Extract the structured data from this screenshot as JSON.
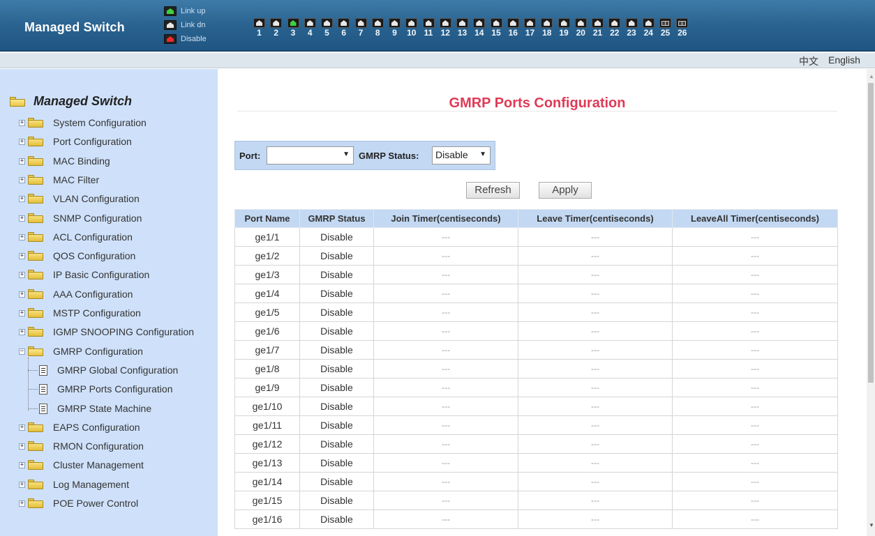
{
  "header": {
    "brand": "Managed Switch",
    "legend": [
      {
        "label": "Link up",
        "icon": "port-link-up-icon",
        "color": "#3fd23f"
      },
      {
        "label": "Link dn",
        "icon": "port-link-down-icon",
        "color": "#e8e8e8"
      },
      {
        "label": "Disable",
        "icon": "port-disabled-icon",
        "color": "#ee2a2a"
      }
    ],
    "ports": [
      {
        "num": "1",
        "state": "down"
      },
      {
        "num": "2",
        "state": "down"
      },
      {
        "num": "3",
        "state": "up"
      },
      {
        "num": "4",
        "state": "down"
      },
      {
        "num": "5",
        "state": "down"
      },
      {
        "num": "6",
        "state": "down"
      },
      {
        "num": "7",
        "state": "down"
      },
      {
        "num": "8",
        "state": "down"
      },
      {
        "num": "9",
        "state": "down"
      },
      {
        "num": "10",
        "state": "down"
      },
      {
        "num": "11",
        "state": "down"
      },
      {
        "num": "12",
        "state": "down"
      },
      {
        "num": "13",
        "state": "down"
      },
      {
        "num": "14",
        "state": "down"
      },
      {
        "num": "15",
        "state": "down"
      },
      {
        "num": "16",
        "state": "down"
      },
      {
        "num": "17",
        "state": "down"
      },
      {
        "num": "18",
        "state": "down"
      },
      {
        "num": "19",
        "state": "down"
      },
      {
        "num": "20",
        "state": "down"
      },
      {
        "num": "21",
        "state": "down"
      },
      {
        "num": "22",
        "state": "down"
      },
      {
        "num": "23",
        "state": "down"
      },
      {
        "num": "24",
        "state": "down"
      },
      {
        "num": "25",
        "state": "sfp"
      },
      {
        "num": "26",
        "state": "sfp"
      }
    ]
  },
  "lang": {
    "chinese": "中文",
    "english": "English"
  },
  "sidebar": {
    "root": "Managed Switch",
    "items": [
      "System Configuration",
      "Port Configuration",
      "MAC Binding",
      "MAC Filter",
      "VLAN Configuration",
      "SNMP Configuration",
      "ACL Configuration",
      "QOS Configuration",
      "IP Basic Configuration",
      "AAA Configuration",
      "MSTP Configuration",
      "IGMP SNOOPING Configuration",
      "GMRP Configuration"
    ],
    "gmrp_children": [
      "GMRP Global Configuration",
      "GMRP Ports Configuration",
      "GMRP State Machine"
    ],
    "items_after": [
      "EAPS Configuration",
      "RMON Configuration",
      "Cluster Management",
      "Log Management",
      "POE Power Control"
    ]
  },
  "main": {
    "title": "GMRP Ports Configuration",
    "filter": {
      "port_label": "Port:",
      "port_value": "",
      "status_label": "GMRP Status:",
      "status_value": "Disable"
    },
    "buttons": {
      "refresh": "Refresh",
      "apply": "Apply"
    },
    "table": {
      "columns": [
        "Port Name",
        "GMRP Status",
        "Join Timer(centiseconds)",
        "Leave Timer(centiseconds)",
        "LeaveAll Timer(centiseconds)"
      ],
      "rows": [
        [
          "ge1/1",
          "Disable",
          "---",
          "---",
          "---"
        ],
        [
          "ge1/2",
          "Disable",
          "---",
          "---",
          "---"
        ],
        [
          "ge1/3",
          "Disable",
          "---",
          "---",
          "---"
        ],
        [
          "ge1/4",
          "Disable",
          "---",
          "---",
          "---"
        ],
        [
          "ge1/5",
          "Disable",
          "---",
          "---",
          "---"
        ],
        [
          "ge1/6",
          "Disable",
          "---",
          "---",
          "---"
        ],
        [
          "ge1/7",
          "Disable",
          "---",
          "---",
          "---"
        ],
        [
          "ge1/8",
          "Disable",
          "---",
          "---",
          "---"
        ],
        [
          "ge1/9",
          "Disable",
          "---",
          "---",
          "---"
        ],
        [
          "ge1/10",
          "Disable",
          "---",
          "---",
          "---"
        ],
        [
          "ge1/11",
          "Disable",
          "---",
          "---",
          "---"
        ],
        [
          "ge1/12",
          "Disable",
          "---",
          "---",
          "---"
        ],
        [
          "ge1/13",
          "Disable",
          "---",
          "---",
          "---"
        ],
        [
          "ge1/14",
          "Disable",
          "---",
          "---",
          "---"
        ],
        [
          "ge1/15",
          "Disable",
          "---",
          "---",
          "---"
        ],
        [
          "ge1/16",
          "Disable",
          "---",
          "---",
          "---"
        ]
      ]
    }
  }
}
